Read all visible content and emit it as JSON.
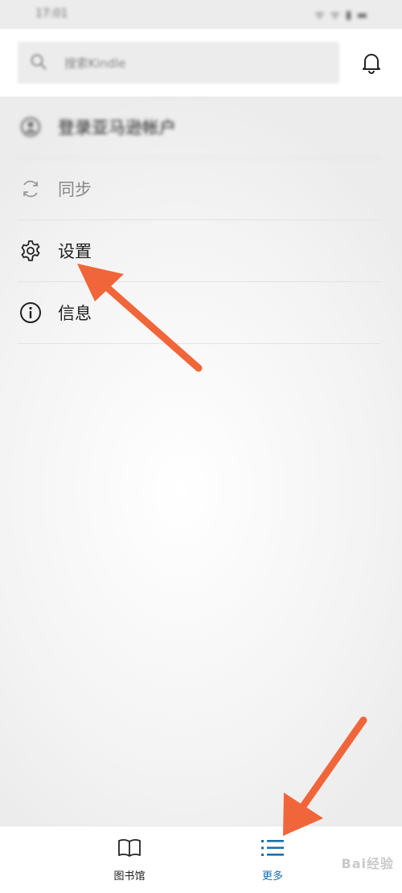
{
  "status_bar": {
    "time": "17:01",
    "icons": "ᯤ ᯤ ▮ ▬"
  },
  "search": {
    "placeholder": "搜索Kindle"
  },
  "menu": {
    "items": [
      {
        "label": "登录亚马逊帐户",
        "icon": "account-icon"
      },
      {
        "label": "同步",
        "icon": "sync-icon"
      },
      {
        "label": "设置",
        "icon": "gear-icon"
      },
      {
        "label": "信息",
        "icon": "info-icon"
      }
    ]
  },
  "bottom_nav": {
    "tabs": [
      {
        "label": "图书馆",
        "icon": "book-icon"
      },
      {
        "label": "更多",
        "icon": "menu-list-icon",
        "active": true
      }
    ]
  },
  "watermark": "Bai经验",
  "colors": {
    "accent": "#1d6fa5",
    "arrow": "#f0663a"
  }
}
